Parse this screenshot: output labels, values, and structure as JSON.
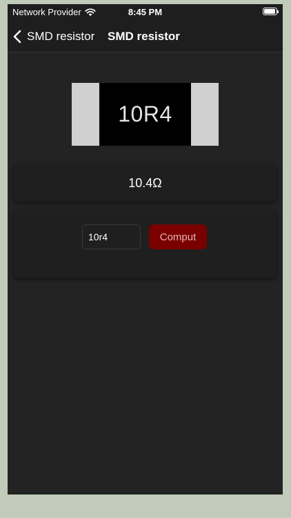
{
  "status_bar": {
    "carrier": "Network Provider",
    "time": "8:45 PM"
  },
  "nav": {
    "back_label": "SMD resistor",
    "title": "SMD resistor"
  },
  "resistor": {
    "code": "10R4"
  },
  "result": {
    "value": "10.4Ω"
  },
  "form": {
    "input_value": "10r4",
    "compute_label": "Comput"
  },
  "colors": {
    "screen_bg": "#232323",
    "card_bg": "#1f1f1f",
    "button_bg": "#7a0000",
    "button_text": "#e8b4b4",
    "resistor_cap": "#d0d0d0",
    "resistor_body": "#000000"
  },
  "icons": {
    "back": "chevron-left-icon",
    "wifi": "wifi-icon",
    "battery": "battery-icon"
  }
}
